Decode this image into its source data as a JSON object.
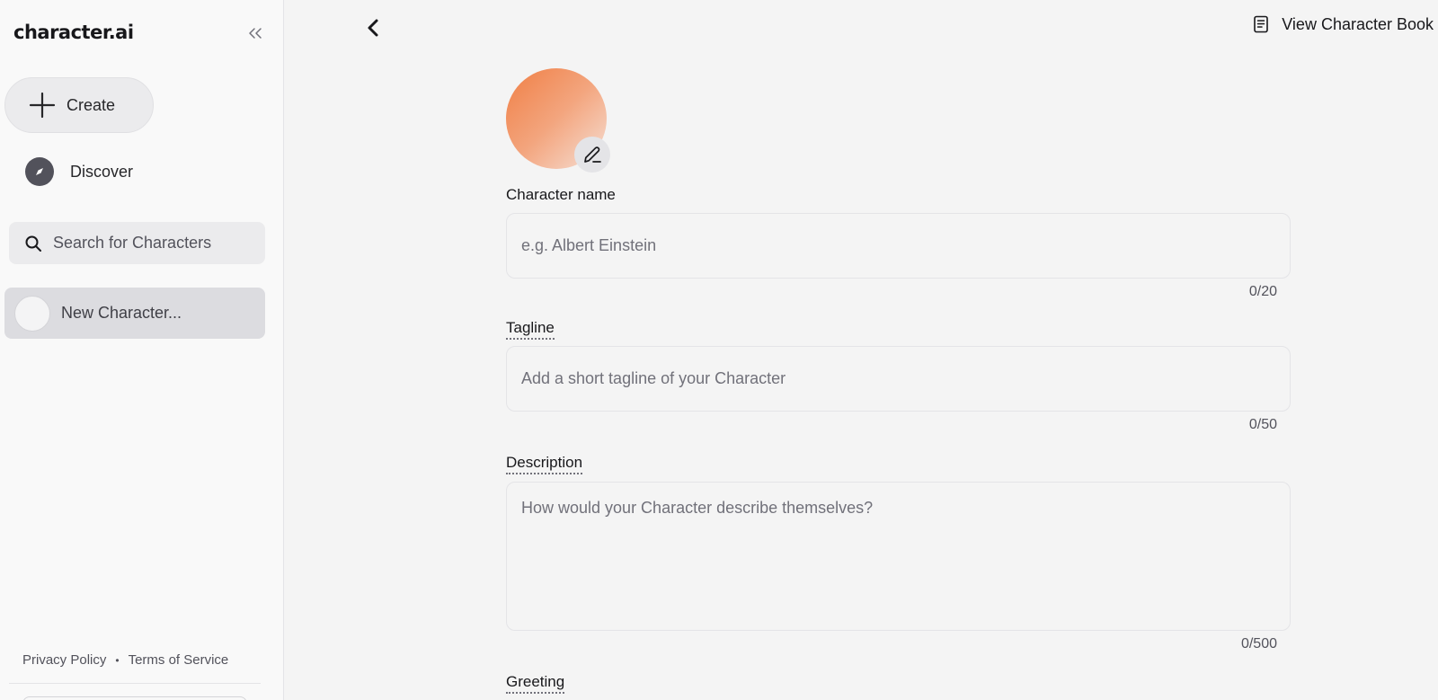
{
  "sidebar": {
    "logo": "character.ai",
    "create_label": "Create",
    "discover_label": "Discover",
    "search_placeholder": "Search for Characters",
    "chat_items": [
      {
        "label": "New Character..."
      }
    ],
    "footer": {
      "privacy": "Privacy Policy",
      "separator": "•",
      "terms": "Terms of Service"
    }
  },
  "header": {
    "view_book_label": "View Character Book"
  },
  "form": {
    "name": {
      "label": "Character name",
      "placeholder": "e.g. Albert Einstein",
      "counter": "0/20"
    },
    "tagline": {
      "label": "Tagline",
      "placeholder": "Add a short tagline of your Character",
      "counter": "0/50"
    },
    "description": {
      "label": "Description",
      "placeholder": "How would your Character describe themselves?",
      "counter": "0/500"
    },
    "greeting": {
      "label": "Greeting"
    }
  },
  "colors": {
    "avatar_gradient_start": "#f07f45",
    "avatar_gradient_end": "#f6e1d7",
    "active_chat_bg": "#dcdce0"
  }
}
